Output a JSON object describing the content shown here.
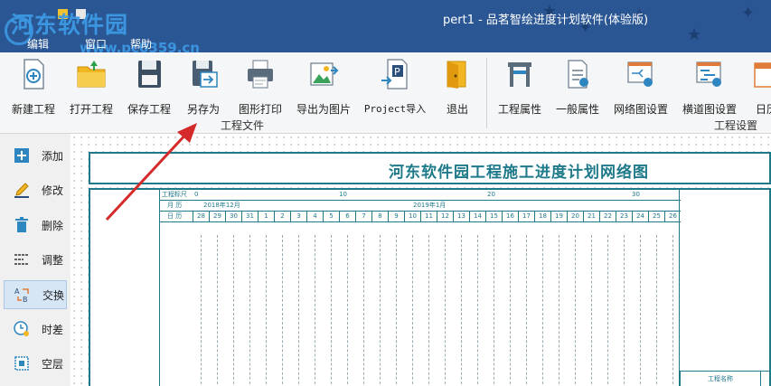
{
  "window": {
    "title": "pert1 - 品茗智绘进度计划软件(体验版)",
    "watermark": "河东软件园",
    "watermark_url": "www.pc0359.cn"
  },
  "menu": [
    "编辑",
    "窗口",
    "帮助"
  ],
  "ribbon": {
    "file_group": {
      "label": "工程文件",
      "buttons": [
        "新建工程",
        "打开工程",
        "保存工程",
        "另存为",
        "图形打印",
        "导出为图片",
        "Project导入",
        "退出"
      ]
    },
    "settings_group": {
      "label": "工程设置",
      "buttons": [
        "工程属性",
        "一般属性",
        "网络图设置",
        "横道图设置",
        "日历"
      ]
    }
  },
  "side_tools": [
    "添加",
    "修改",
    "删除",
    "调整",
    "交换",
    "时差",
    "空层"
  ],
  "active_tool": "交换",
  "chart": {
    "title": "河东软件园工程施工进度计划网络图",
    "row_labels": [
      "工程标尺",
      "月  历",
      "日  历"
    ],
    "scale_marks": [
      "0",
      "10",
      "20",
      "30"
    ],
    "months": [
      "2018年12月",
      "2019年1月"
    ],
    "days": [
      "28",
      "29",
      "30",
      "31",
      "1",
      "2",
      "3",
      "4",
      "5",
      "6",
      "7",
      "8",
      "9",
      "10",
      "11",
      "12",
      "13",
      "14",
      "15",
      "16",
      "17",
      "18",
      "19",
      "20",
      "21",
      "22",
      "23",
      "24",
      "25",
      "26"
    ],
    "info_label": "工程名称"
  },
  "colors": {
    "title_bar": "#2a5694",
    "chart_line": "#1e7a8a",
    "annotation_arrow": "#d42a2a"
  }
}
